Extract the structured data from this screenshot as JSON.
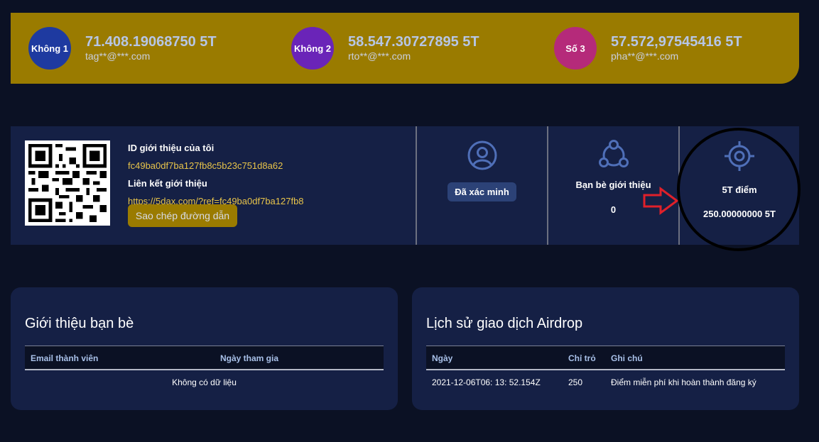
{
  "leaderboard": [
    {
      "badge": "Không 1",
      "amount": "71.408.19068750 5T",
      "email": "tag**@***.com",
      "color": "#1e3aa0"
    },
    {
      "badge": "Không 2",
      "amount": "58.547.30727895 5T",
      "email": "rto**@***.com",
      "color": "#6a24b8"
    },
    {
      "badge": "Số 3",
      "amount": "57.572,97545416 5T",
      "email": "pha**@***.com",
      "color": "#b52a7a"
    }
  ],
  "referral": {
    "id_label": "ID giới thiệu của tôi",
    "id_value": "fc49ba0df7ba127fb8c5b23c751d8a62",
    "link_label": "Liên kết giới thiệu",
    "link_value": "https://5dax.com/?ref=fc49ba0df7ba127fb8",
    "copy_button": "Sao chép đường dẫn"
  },
  "status": {
    "verified_label": "Đã xác minh",
    "friends_label": "Bạn bè giới thiệu",
    "friends_count": "0",
    "points_label": "5T điểm",
    "points_value": "250.00000000 5T"
  },
  "friends_card": {
    "title": "Giới thiệu bạn bè",
    "columns": [
      "Email thành viên",
      "Ngày tham gia"
    ],
    "empty_text": "Không có dữ liệu"
  },
  "airdrop_card": {
    "title": "Lịch sử giao dịch Airdrop",
    "columns": [
      "Ngày",
      "Chỉ trỏ",
      "Ghi chú"
    ],
    "rows": [
      {
        "date": "2021-12-06T06: 13: 52.154Z",
        "amount": "250",
        "note": "Điểm miễn phí khi hoàn thành đăng ký"
      }
    ]
  },
  "icons": {
    "verify": "user-circle-icon",
    "friends": "network-icon",
    "points": "target-icon",
    "arrow": "arrow-right-icon"
  },
  "colors": {
    "gold": "#9a7b00",
    "panel": "#152045",
    "background": "#0b1124",
    "accent_text": "#e8c44a",
    "icon_blue": "#4f6fb8",
    "arrow_red": "#e0202a"
  }
}
